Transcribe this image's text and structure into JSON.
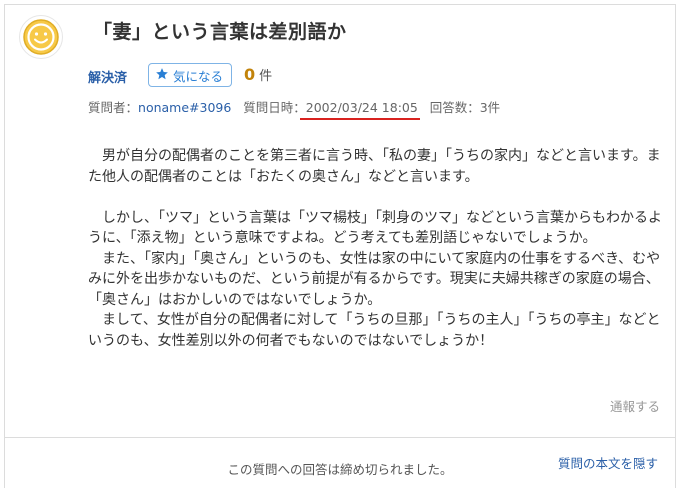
{
  "question": {
    "title": "「妻」という言葉は差別語か",
    "status_label": "解決済",
    "favorite_button_label": "気になる",
    "favorite_count": "0",
    "favorite_unit": "件",
    "questioner_label": "質問者：",
    "questioner": "noname#3096",
    "date_label": "質問日時：",
    "date": "2002/03/24 18:05",
    "answers_label": "回答数：3件",
    "body": "　男が自分の配偶者のことを第三者に言う時、「私の妻」「うちの家内」などと言います。また他人の配偶者のことは「おたくの奥さん」などと言います。\n\n　しかし、「ツマ」という言葉は「ツマ楊枝」「刺身のツマ」などという言葉からもわかるように、「添え物」という意味ですよね。どう考えても差別語じゃないでしょうか。\n　また、「家内」「奥さん」というのも、女性は家の中にいて家庭内の仕事をするべき、むやみに外を出歩かないものだ、という前提が有るからです。現実に夫婦共稼ぎの家庭の場合、「奥さん」はおかしいのではないでしょうか。\n　まして、女性が自分の配偶者に対して「うちの旦那」「うちの主人」「うちの亭主」などというのも、女性差別以外の何者でもないのではないでしょうか！",
    "report_label": "通報する"
  },
  "footer": {
    "closed_message": "この質問への回答は締め切られました。",
    "hide_body_link": "質問の本文を隠す"
  },
  "colors": {
    "accent_blue": "#2a5fa8",
    "favorite_orange": "#c2830a",
    "highlight_red": "#d9221f",
    "avatar_yellow": "#f7c948"
  },
  "icons": {
    "avatar": "smiley-face-icon",
    "favorite": "star-icon"
  }
}
